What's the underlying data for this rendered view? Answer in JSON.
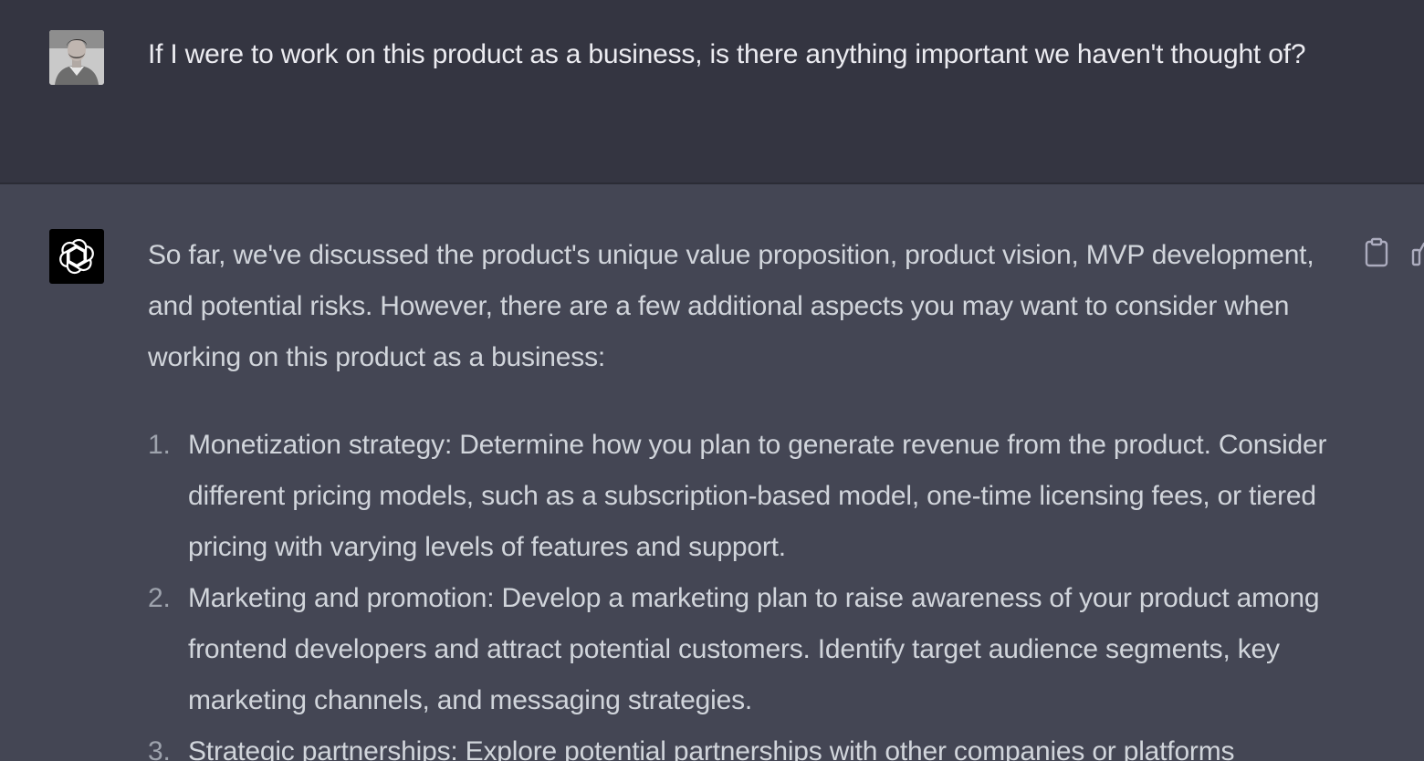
{
  "conversation": {
    "user_message": {
      "text": "If I were to work on this product as a business, is there anything important we haven't thought of?"
    },
    "assistant_message": {
      "intro": "So far, we've discussed the product's unique value proposition, product vision, MVP development, and potential risks. However, there are a few additional aspects you may want to consider when working on this product as a business:",
      "items": [
        {
          "number": "1.",
          "text": "Monetization strategy: Determine how you plan to generate revenue from the product. Consider different pricing models, such as a subscription-based model, one-time licensing fees, or tiered pricing with varying levels of features and support."
        },
        {
          "number": "2.",
          "text": "Marketing and promotion: Develop a marketing plan to raise awareness of your product among frontend developers and attract potential customers. Identify target audience segments, key marketing channels, and messaging strategies."
        },
        {
          "number": "3.",
          "text": "Strategic partnerships: Explore potential partnerships with other companies or platforms"
        }
      ]
    },
    "actions": {
      "copy_icon": "clipboard-icon",
      "thumb_icon": "thumbs-up-icon"
    }
  },
  "colors": {
    "user_bg": "#343541",
    "assistant_bg": "#444654",
    "user_text": "#ececf1",
    "assistant_text": "#d1d5db",
    "bot_avatar_bg": "#000000"
  }
}
